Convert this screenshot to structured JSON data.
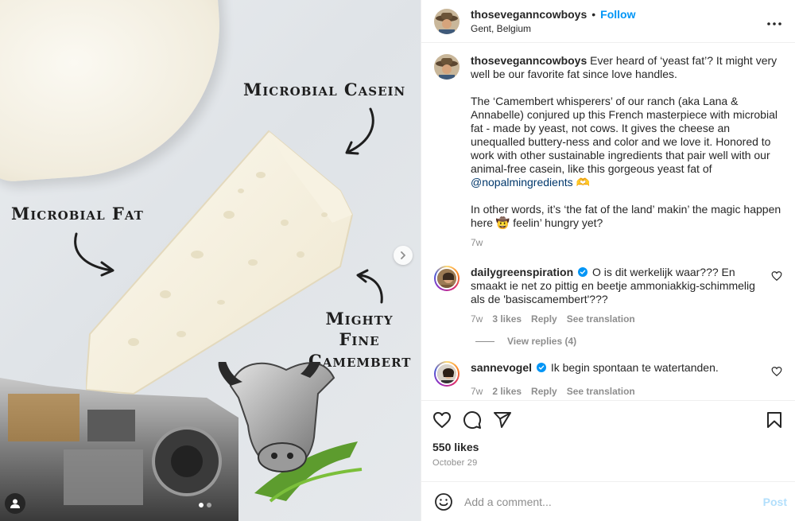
{
  "media": {
    "annotations": {
      "casein": "Microbial Casein",
      "fat": "Microbial Fat",
      "camembert_line1": "Mighty Fine",
      "camembert_line2": "Camembert"
    },
    "icons": {
      "next": "chevron-right-icon",
      "tags": "user-tag-icon"
    },
    "carousel_total": 2,
    "carousel_index": 1
  },
  "post": {
    "author": "thoseveganncowboys",
    "follow_label": "Follow",
    "location": "Gent, Belgium",
    "separator": "•",
    "more_label": "•••"
  },
  "caption": {
    "username": "thoseveganncowboys",
    "p1": "Ever heard of ‘yeast fat’? It might very well be our favorite fat since love handles.",
    "p2_text": "The ‘Camembert whisperers’ of our ranch (aka Lana & Annabelle) conjured up this French masterpiece with microbial fat - made by yeast, not cows. It gives the cheese an unequalled buttery-ness and color and we love it. Honored to work with other sustainable ingredients that pair well with our animal-free casein, like this gorgeous yeast fat of ",
    "p2_mention": "@nopalmingredients",
    "p2_emoji": "🫶",
    "p3": "In other words, it’s ‘the fat of the land’ makin’ the magic happen here 🤠 feelin’ hungry yet?",
    "time": "7w"
  },
  "comments": [
    {
      "username": "dailygreenspiration",
      "verified": true,
      "text": "O is dit werkelijk waar??? En smaakt ie net zo pittig en beetje ammoniakkig-schimmelig als de 'basiscamembert'???",
      "time": "7w",
      "likes": "3 likes",
      "reply": "Reply",
      "translate": "See translation",
      "view_replies": "View replies (4)"
    },
    {
      "username": "sannevogel",
      "verified": true,
      "text": "Ik begin spontaan te watertanden.",
      "time": "7w",
      "likes": "2 likes",
      "reply": "Reply",
      "translate": "See translation"
    }
  ],
  "actions": {
    "likes": "550 likes",
    "date": "October 29",
    "icons": [
      "heart-icon",
      "comment-icon",
      "share-icon",
      "bookmark-icon"
    ]
  },
  "add_comment": {
    "placeholder": "Add a comment...",
    "post_label": "Post"
  },
  "colors": {
    "link": "#0095f6",
    "mention": "#00376b",
    "muted": "#8e8e8e",
    "post_disabled": "#b2dffc"
  }
}
